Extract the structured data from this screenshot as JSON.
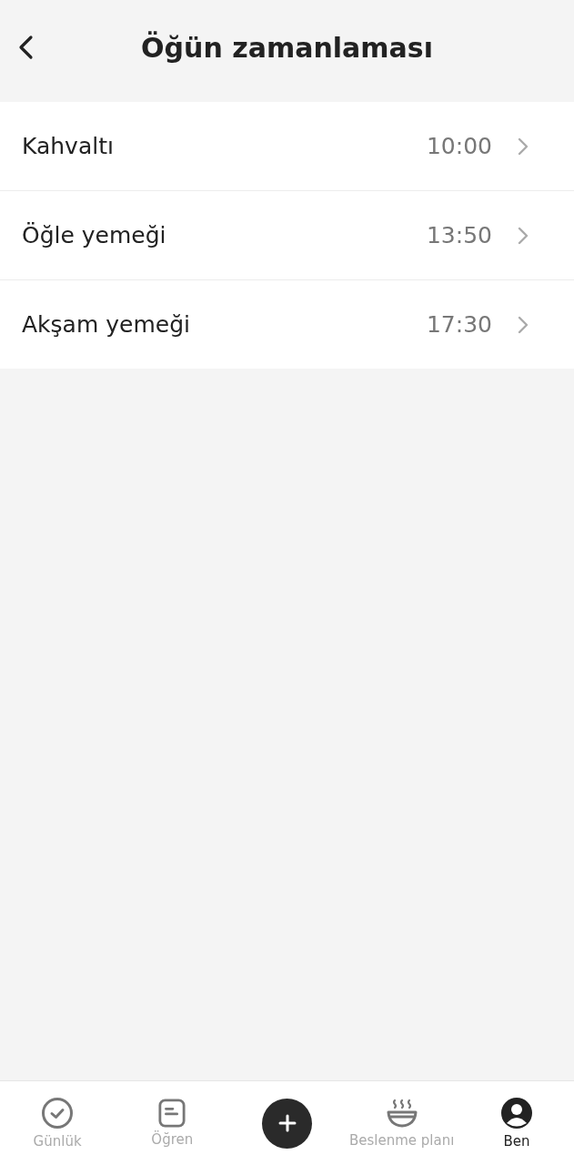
{
  "header": {
    "title": "Öğün zamanlaması"
  },
  "meals": [
    {
      "name": "Kahvaltı",
      "time": "10:00"
    },
    {
      "name": "Öğle yemeği",
      "time": "13:50"
    },
    {
      "name": "Akşam yemeği",
      "time": "17:30"
    }
  ],
  "tab_bar": [
    {
      "kind": "check",
      "label": "Günlük",
      "selected": false
    },
    {
      "kind": "note",
      "label": "Öğren",
      "selected": false
    },
    {
      "kind": "add"
    },
    {
      "kind": "bowl",
      "label": "Beslenme planı",
      "selected": false
    },
    {
      "kind": "person",
      "label": "Ben",
      "selected": true
    }
  ]
}
